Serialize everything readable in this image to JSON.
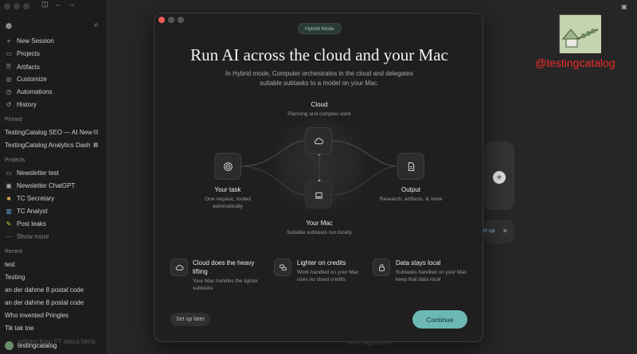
{
  "sidebar": {
    "nav": [
      {
        "icon": "plus-icon",
        "label": "New Session"
      },
      {
        "icon": "folder-icon",
        "label": "Projects"
      },
      {
        "icon": "artifact-icon",
        "label": "Artifacts"
      },
      {
        "icon": "customize-icon",
        "label": "Customize"
      },
      {
        "icon": "clock-icon",
        "label": "Automations"
      },
      {
        "icon": "history-icon",
        "label": "History"
      }
    ],
    "pinned_label": "Pinned",
    "pinned": [
      "TestingCatalog SEO — AI News",
      "TestingCatalog Analytics Dash"
    ],
    "projects_label": "Projects",
    "projects": [
      {
        "icon": "folder-icon",
        "label": "Newsletter test"
      },
      {
        "icon": "book-icon",
        "label": "Newsletter ChatGPT"
      },
      {
        "icon": "briefcase-icon",
        "label": "TC Secretary"
      },
      {
        "icon": "chart-icon",
        "label": "TC Analyst"
      },
      {
        "icon": "pencil-icon",
        "label": "Post leaks"
      },
      {
        "icon": "ellipsis-icon",
        "label": "Show more"
      }
    ],
    "recent_label": "Recent",
    "recent": [
      "test",
      "Testing",
      "an der dahme 8 postal code",
      "an der dahme 8 postal code",
      "Who invented Pringles",
      "Tik tak toe"
    ],
    "overlay_text": "articles from FT about Meta",
    "user_name": "testingcatalog"
  },
  "watermark": {
    "text": "@testingcatalog"
  },
  "background": {
    "setup_link": "et up",
    "suggestions": "Show suggestions ⌄"
  },
  "modal": {
    "badge": "Hybrid Mode",
    "title": "Run AI across the cloud and your Mac",
    "subtitle": "In Hybrid mode, Computer orchestrates in the cloud and delegates suitable subtasks to a model on your Mac.",
    "diagram": {
      "cloud": {
        "label": "Cloud",
        "sub": "Planning and complex work"
      },
      "task": {
        "label": "Your task",
        "sub": "One request, routed automatically"
      },
      "mac": {
        "label": "Your Mac",
        "sub": "Suitable subtasks run locally"
      },
      "output": {
        "label": "Output",
        "sub": "Research, artifacts, & more"
      }
    },
    "features": [
      {
        "icon": "cloud-icon",
        "title": "Cloud does the heavy lifting",
        "desc": "Your Mac handles the lighter subtasks"
      },
      {
        "icon": "coins-icon",
        "title": "Lighter on credits",
        "desc": "Work handled on your Mac uses no cloud credits"
      },
      {
        "icon": "lock-icon",
        "title": "Data stays local",
        "desc": "Subtasks handled on your Mac keep that data local"
      }
    ],
    "setup_later": "Set up later",
    "continue": "Continue"
  }
}
